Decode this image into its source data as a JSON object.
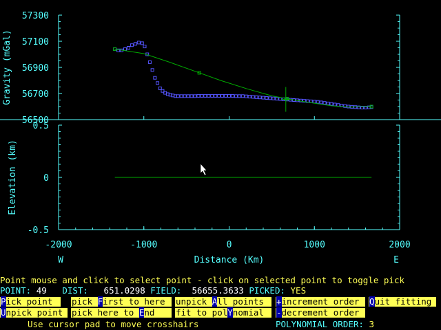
{
  "colors": {
    "axis": "#55ffff",
    "text_cyan": "#55ffff",
    "gravity_points": "#5555ff",
    "fit_line": "#00aa00",
    "highlight": "#ffff55",
    "hotkey_bg": "#0000aa"
  },
  "chart_data": [
    {
      "type": "scatter",
      "ylabel": "Gravity (mGal)",
      "xlim": [
        -2000,
        2000
      ],
      "ylim": [
        56500,
        57300
      ],
      "y_ticks": [
        "57300",
        "57100",
        "56900",
        "56700",
        "56500"
      ],
      "series": [
        {
          "x": [
            -1340,
            -1300,
            -1260,
            -1220,
            -1180,
            -1140,
            -1100,
            -1060,
            -1020,
            -990,
            -960,
            -930,
            -900,
            -870,
            -840,
            -810,
            -780,
            -750,
            -720,
            -690,
            -660,
            -630,
            -600,
            -560,
            -520,
            -480,
            -440,
            -400,
            -360,
            -320,
            -280,
            -240,
            -200,
            -160,
            -120,
            -80,
            -40,
            0,
            40,
            80,
            120,
            160,
            200,
            240,
            280,
            320,
            360,
            400,
            440,
            480,
            520,
            560,
            600,
            640,
            680,
            720,
            760,
            800,
            840,
            880,
            920,
            960,
            1000,
            1040,
            1080,
            1120,
            1160,
            1200,
            1240,
            1280,
            1320,
            1360,
            1400,
            1440,
            1480,
            1520,
            1560,
            1600,
            1640,
            1670
          ],
          "y": [
            57040,
            57030,
            57030,
            57040,
            57050,
            57070,
            57080,
            57090,
            57085,
            57060,
            57000,
            56940,
            56880,
            56820,
            56780,
            56740,
            56720,
            56705,
            56695,
            56690,
            56685,
            56680,
            56680,
            56680,
            56680,
            56680,
            56680,
            56680,
            56682,
            56682,
            56682,
            56682,
            56682,
            56682,
            56682,
            56682,
            56682,
            56682,
            56682,
            56680,
            56680,
            56680,
            56678,
            56676,
            56674,
            56672,
            56670,
            56668,
            56666,
            56664,
            56662,
            56660,
            56658,
            56656,
            56654,
            56652,
            56650,
            56648,
            56646,
            56644,
            56642,
            56640,
            56638,
            56636,
            56632,
            56628,
            56624,
            56620,
            56616,
            56612,
            56608,
            56604,
            56600,
            56598,
            56596,
            56594,
            56592,
            56592,
            56594,
            56596
          ]
        },
        {
          "x": [
            -1340,
            -1000,
            -700,
            -400,
            -100,
            200,
            500,
            680,
            800,
            1000,
            1200,
            1400,
            1670
          ],
          "y": [
            57040,
            57005,
            56940,
            56870,
            56800,
            56738,
            56682,
            56660,
            56646,
            56626,
            56606,
            56596,
            56600
          ]
        }
      ],
      "fit_markers_x": [
        -1340,
        -350,
        680,
        1670
      ],
      "crosshair": {
        "x": 665,
        "y": 56655
      }
    },
    {
      "type": "line",
      "xlabel": "Distance (Km)",
      "ylabel": "Elevation (km)",
      "xlim": [
        -2000,
        2000
      ],
      "ylim": [
        -0.5,
        0.5
      ],
      "x_ticks": [
        "-2000",
        "-1000",
        "0",
        "1000",
        "2000"
      ],
      "y_ticks": [
        "0.5",
        "0",
        "-0.5"
      ],
      "series": [
        {
          "x": [
            -1340,
            1670
          ],
          "y": [
            0,
            0
          ]
        }
      ],
      "direction_left": "W",
      "direction_right": "E"
    }
  ],
  "instruction": "Point mouse and click to select point - click on selected point to toggle pick",
  "status": {
    "point_label": "POINT:",
    "point_value": "49",
    "dist_label": "DIST:",
    "dist_value": "651.0298",
    "field_label": "FIELD:",
    "field_value": "56655.3633",
    "picked_label": "PICKED:",
    "picked_value": "YES"
  },
  "buttons": {
    "pick_point": {
      "hotkey": "P",
      "rest": "ick point"
    },
    "pick_first": {
      "pre": "pick ",
      "hotkey": "F",
      "rest": "irst to here"
    },
    "unpick_all": {
      "pre": "unpick ",
      "hotkey": "A",
      "rest": "ll points"
    },
    "increment": {
      "hotkey": "+",
      "rest": "increment order"
    },
    "quit": {
      "hotkey": "Q",
      "rest": "uit fitting"
    },
    "unpick_point": {
      "hotkey": "U",
      "rest": "npick point"
    },
    "pick_end": {
      "pre": "pick here to ",
      "hotkey": "E",
      "rest": "nd"
    },
    "fit_poly": {
      "pre": "fit to pol",
      "hotkey": "Y",
      "rest": "nomial"
    },
    "decrement": {
      "hotkey": "-",
      "rest": "decrement order"
    }
  },
  "hint": "Use cursor pad to move crosshairs",
  "poly_label": "POLYNOMIAL ORDER:",
  "poly_value": "3"
}
